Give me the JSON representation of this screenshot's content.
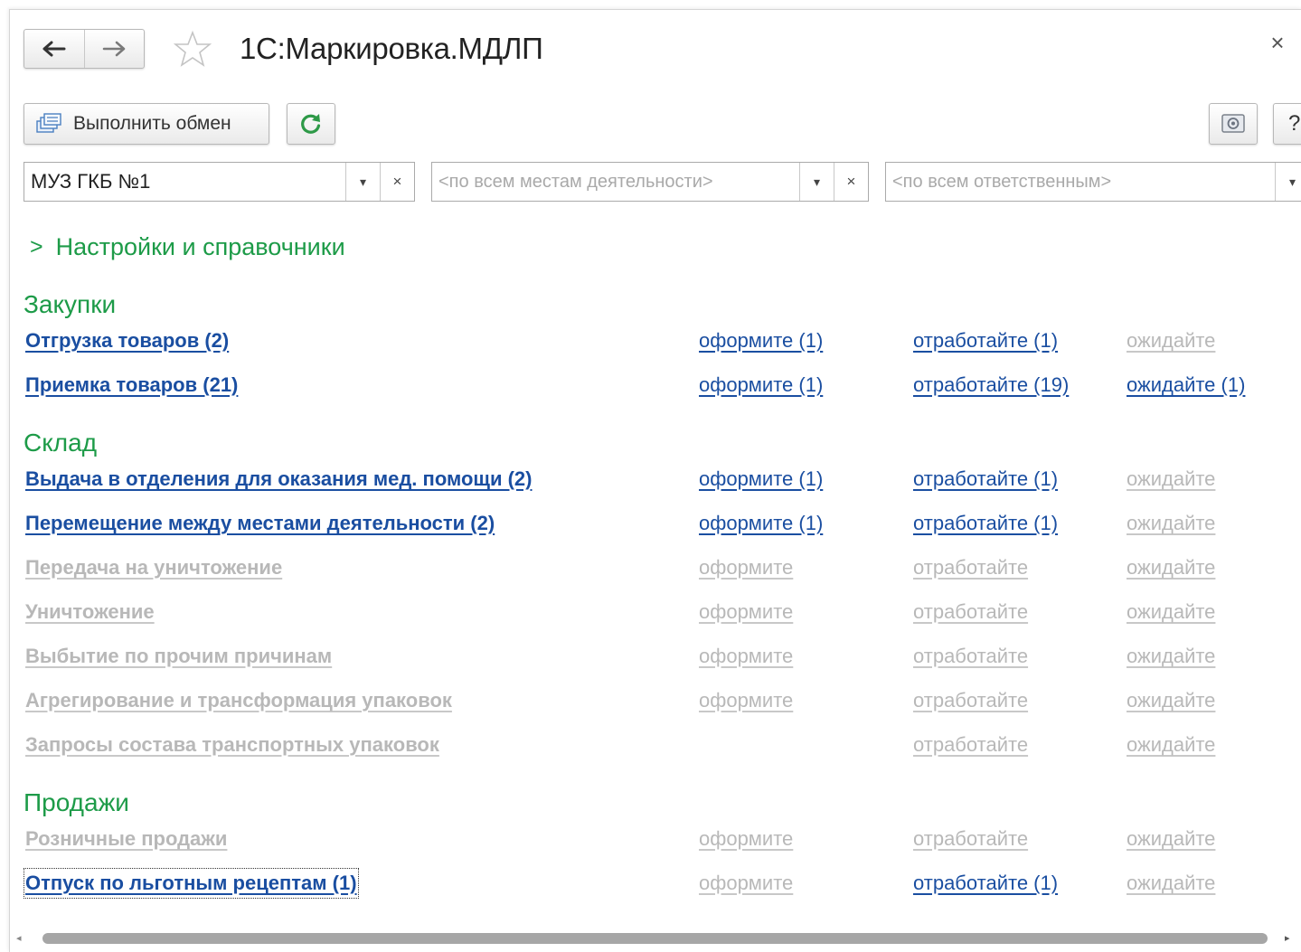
{
  "window": {
    "title": "1С:Маркировка.МДЛП",
    "close_symbol": "×"
  },
  "toolbar": {
    "exchange_label": "Выполнить обмен",
    "help_label": "?"
  },
  "filters": {
    "organization": "МУЗ ГКБ №1",
    "place_placeholder": "<по всем местам деятельности>",
    "responsible_placeholder": "<по всем ответственным>"
  },
  "settings_link": "Настройки и справочники",
  "sections": {
    "purchases": {
      "title": "Закупки",
      "rows": [
        {
          "name": "Отгрузка товаров (2)",
          "name_active": true,
          "c1": "оформите (1)",
          "c1_active": true,
          "c2": "отработайте (1)",
          "c2_active": true,
          "c3": "ожидайте",
          "c3_active": false
        },
        {
          "name": "Приемка товаров (21)",
          "name_active": true,
          "c1": "оформите (1)",
          "c1_active": true,
          "c2": "отработайте (19)",
          "c2_active": true,
          "c3": "ожидайте (1)",
          "c3_active": true
        }
      ]
    },
    "warehouse": {
      "title": "Склад",
      "rows": [
        {
          "name": "Выдача в отделения для оказания мед. помощи (2)",
          "name_active": true,
          "c1": "оформите (1)",
          "c1_active": true,
          "c2": "отработайте (1)",
          "c2_active": true,
          "c3": "ожидайте",
          "c3_active": false
        },
        {
          "name": "Перемещение между местами деятельности (2)",
          "name_active": true,
          "c1": "оформите (1)",
          "c1_active": true,
          "c2": "отработайте (1)",
          "c2_active": true,
          "c3": "ожидайте",
          "c3_active": false
        },
        {
          "name": "Передача на уничтожение",
          "name_active": false,
          "c1": "оформите",
          "c1_active": false,
          "c2": "отработайте",
          "c2_active": false,
          "c3": "ожидайте",
          "c3_active": false
        },
        {
          "name": "Уничтожение",
          "name_active": false,
          "c1": "оформите",
          "c1_active": false,
          "c2": "отработайте",
          "c2_active": false,
          "c3": "ожидайте",
          "c3_active": false
        },
        {
          "name": "Выбытие по прочим причинам",
          "name_active": false,
          "c1": "оформите",
          "c1_active": false,
          "c2": "отработайте",
          "c2_active": false,
          "c3": "ожидайте",
          "c3_active": false
        },
        {
          "name": "Агрегирование и трансформация упаковок",
          "name_active": false,
          "c1": "оформите",
          "c1_active": false,
          "c2": "отработайте",
          "c2_active": false,
          "c3": "ожидайте",
          "c3_active": false
        },
        {
          "name": "Запросы состава транспортных упаковок",
          "name_active": false,
          "c1": "",
          "c1_active": false,
          "c2": "отработайте",
          "c2_active": false,
          "c3": "ожидайте",
          "c3_active": false
        }
      ]
    },
    "sales": {
      "title": "Продажи",
      "rows": [
        {
          "name": "Розничные продажи",
          "name_active": false,
          "c1": "оформите",
          "c1_active": false,
          "c2": "отработайте",
          "c2_active": false,
          "c3": "ожидайте",
          "c3_active": false
        },
        {
          "name": "Отпуск по льготным рецептам (1)",
          "name_active": true,
          "c1": "оформите",
          "c1_active": false,
          "c2": "отработайте (1)",
          "c2_active": true,
          "c3": "ожидайте",
          "c3_active": false
        }
      ]
    }
  },
  "colors": {
    "section_green": "#1d9b48",
    "link_blue": "#1a4ea1",
    "inactive_gray": "#b8b8b8"
  },
  "icons": {
    "back": "arrow-left-icon",
    "forward": "arrow-right-icon",
    "favorite": "star-icon",
    "exchange": "exchange-icon",
    "refresh": "refresh-icon",
    "settings": "screen-settings-icon"
  }
}
